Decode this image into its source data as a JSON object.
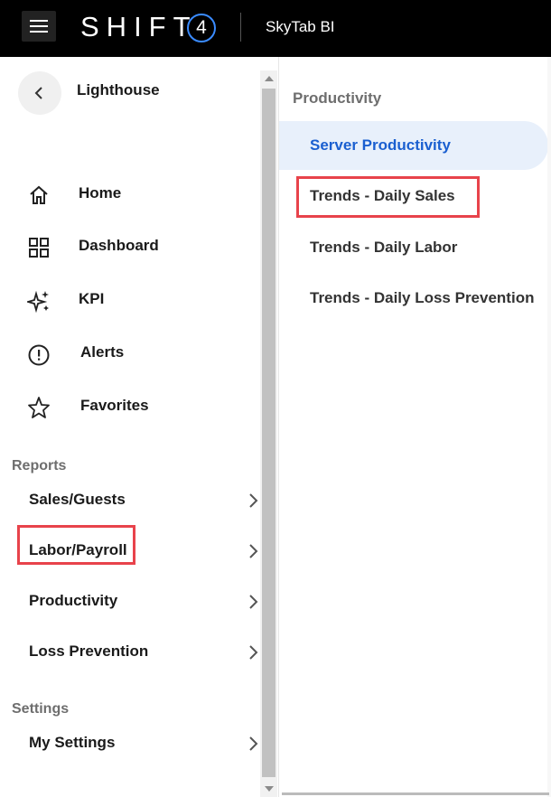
{
  "header": {
    "brand": "SHIFT",
    "brand_mark": "4",
    "product": "SkyTab BI"
  },
  "sidebar": {
    "app_name": "Lighthouse",
    "nav": [
      {
        "label": "Home",
        "icon": "home-icon"
      },
      {
        "label": "Dashboard",
        "icon": "grid-icon"
      },
      {
        "label": "KPI",
        "icon": "sparkle-icon"
      },
      {
        "label": "Alerts",
        "icon": "alert-circle-icon"
      },
      {
        "label": "Favorites",
        "icon": "star-icon"
      }
    ],
    "reports_heading": "Reports",
    "reports": [
      {
        "label": "Sales/Guests"
      },
      {
        "label": "Labor/Payroll"
      },
      {
        "label": "Productivity"
      },
      {
        "label": "Loss Prevention"
      }
    ],
    "settings_heading": "Settings",
    "settings": [
      {
        "label": "My Settings"
      }
    ]
  },
  "submenu": {
    "title": "Productivity",
    "items": [
      {
        "label": "Server Productivity",
        "active": true
      },
      {
        "label": "Trends - Daily Sales",
        "active": false
      },
      {
        "label": "Trends - Daily Labor",
        "active": false
      },
      {
        "label": "Trends - Daily Loss Prevention",
        "active": false
      }
    ]
  },
  "colors": {
    "topbar": "#000000",
    "accent_blue": "#1a5fd0",
    "active_bg": "#e8f0fb",
    "highlight_red": "#e8434b"
  }
}
